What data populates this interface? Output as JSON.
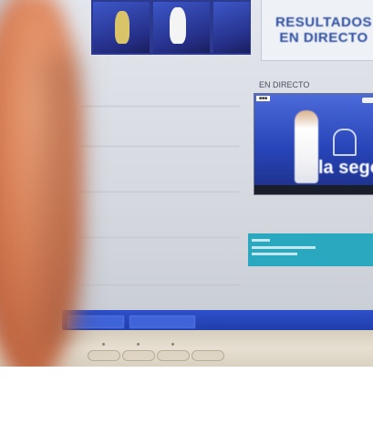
{
  "header": {
    "resultados_line1": "RESULTADOS",
    "resultados_line2": "EN DIRECTO"
  },
  "live_panel": {
    "title": "EN DIRECTO",
    "video_overlay_text": "la segovi"
  },
  "colors": {
    "banner_blue": "#2b3a8f",
    "resultados_text": "#2f4fa0",
    "video_blue": "#2745b8",
    "cyan_box": "#2aa8c0",
    "taskbar_blue": "#1f3ca8",
    "bezel_beige": "#e7e0d2",
    "finger_skin": "#d47a52"
  }
}
